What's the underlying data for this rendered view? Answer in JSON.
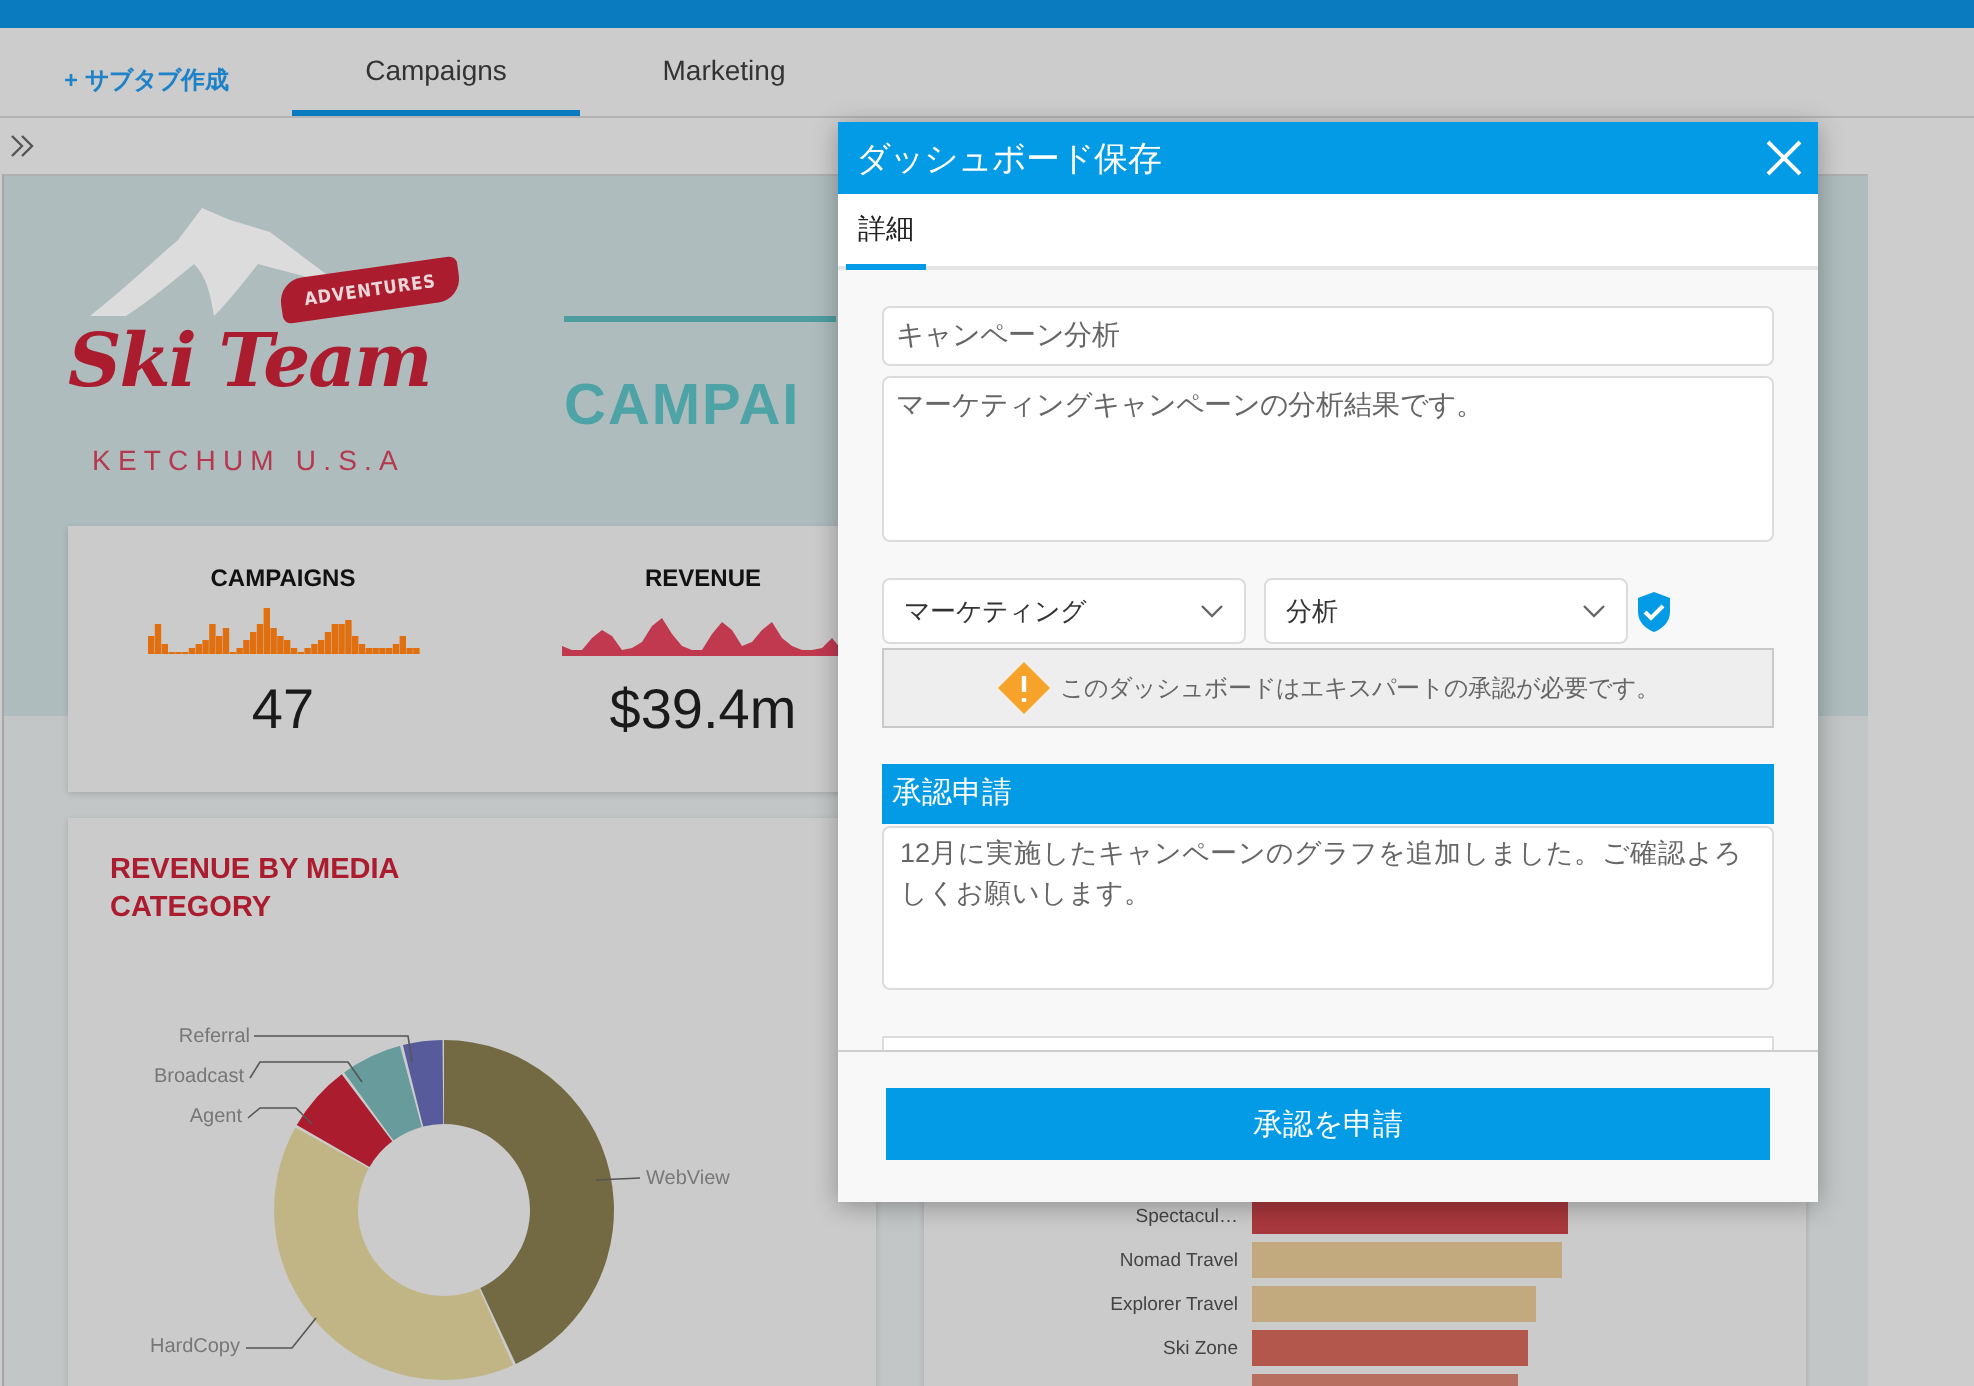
{
  "top_nav": {
    "create_subtab": "+ サブタブ作成",
    "tabs": [
      {
        "label": "Campaigns",
        "selected": true
      },
      {
        "label": "Marketing",
        "selected": false
      }
    ]
  },
  "dashboard": {
    "logo": {
      "badge": "ADVENTURES",
      "name": "Ski Team",
      "location": "KETCHUM U.S.A"
    },
    "title": "CAMPAI",
    "kpis": [
      {
        "label": "CAMPAIGNS",
        "value": "47",
        "kind": "bars"
      },
      {
        "label": "REVENUE",
        "value": "$39.4m",
        "kind": "area"
      }
    ],
    "media_chart": {
      "title": "REVENUE BY MEDIA CATEGORY",
      "segments": [
        {
          "label": "Referral",
          "color": "#575a9b"
        },
        {
          "label": "Broadcast",
          "color": "#689b9c"
        },
        {
          "label": "Agent",
          "color": "#ab1c2f"
        },
        {
          "label": "WebView",
          "color": "#736a44"
        },
        {
          "label": "HardCopy",
          "color": "#c2b585"
        }
      ]
    },
    "bar_chart": {
      "rows": [
        {
          "label": "Spectacul…",
          "color": "#a8383d"
        },
        {
          "label": "Nomad Travel",
          "color": "#c2a97e"
        },
        {
          "label": "Explorer Travel",
          "color": "#c2a97e"
        },
        {
          "label": "Ski Zone",
          "color": "#b3574d"
        },
        {
          "color": "#b77060"
        }
      ]
    }
  },
  "dialog": {
    "title": "ダッシュボード保存",
    "tabs": [
      {
        "label": "詳細",
        "selected": true
      }
    ],
    "name_field": {
      "value": "キャンペーン分析"
    },
    "description_field": {
      "value": "マーケティングキャンペーンの分析結果です。"
    },
    "category_select": {
      "value": "マーケティング"
    },
    "subcategory_select": {
      "value": "分析"
    },
    "verified": true,
    "warning": "このダッシュボードはエキスパートの承認が必要です。",
    "approval": {
      "heading": "承認申請",
      "message": "12月に実施したキャンペーンのグラフを追加しました。ご確認よろしくお願いします。"
    },
    "submit_button": "承認を申請"
  }
}
